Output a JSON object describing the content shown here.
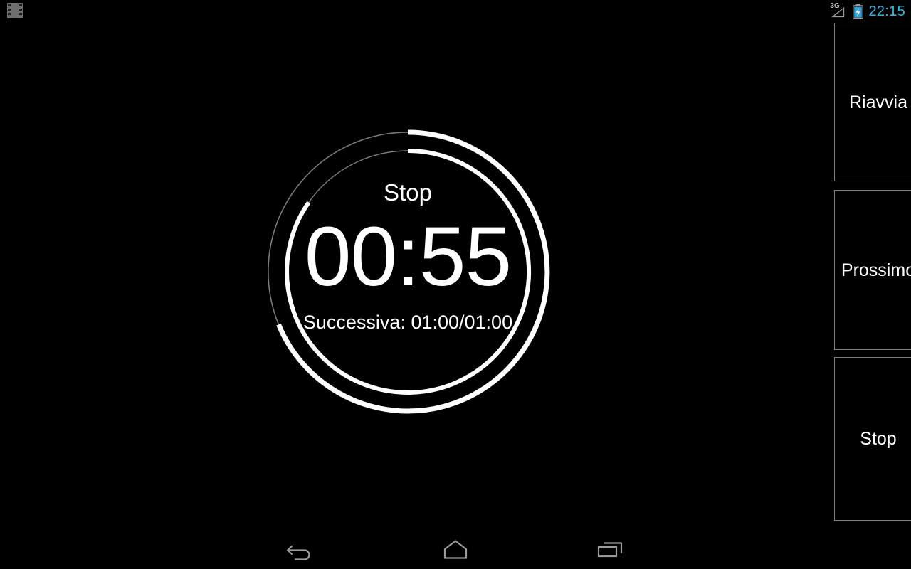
{
  "status_bar": {
    "app_icon": "film-strip-icon",
    "network_type": "3G",
    "signal_icon": "signal-triangle-icon",
    "battery_icon": "battery-charging-icon",
    "clock": "22:15",
    "clock_color": "#3ab3e5",
    "icon_color": "#9a9a9a"
  },
  "timer": {
    "state_label": "Stop",
    "remaining": "00:55",
    "next_info": "Successiva: 01:00/01:00",
    "ring_color": "#ffffff",
    "track_color": "#777777",
    "outer_ring": {
      "name": "total-progress-ring",
      "sweep_degrees": 248,
      "track_sweep_degrees": 112
    },
    "inner_ring": {
      "name": "interval-progress-ring",
      "sweep_degrees": 305,
      "track_sweep_degrees": 55
    }
  },
  "buttons": [
    {
      "id": "restart",
      "label": "Riavvia",
      "name": "restart-button"
    },
    {
      "id": "next",
      "label": "Prossimo",
      "name": "next-button"
    },
    {
      "id": "stop",
      "label": "Stop",
      "name": "stop-button"
    }
  ],
  "nav_bar": {
    "back": "back-icon",
    "home": "home-icon",
    "recents": "recents-icon",
    "icon_color": "#9b9b9b"
  }
}
